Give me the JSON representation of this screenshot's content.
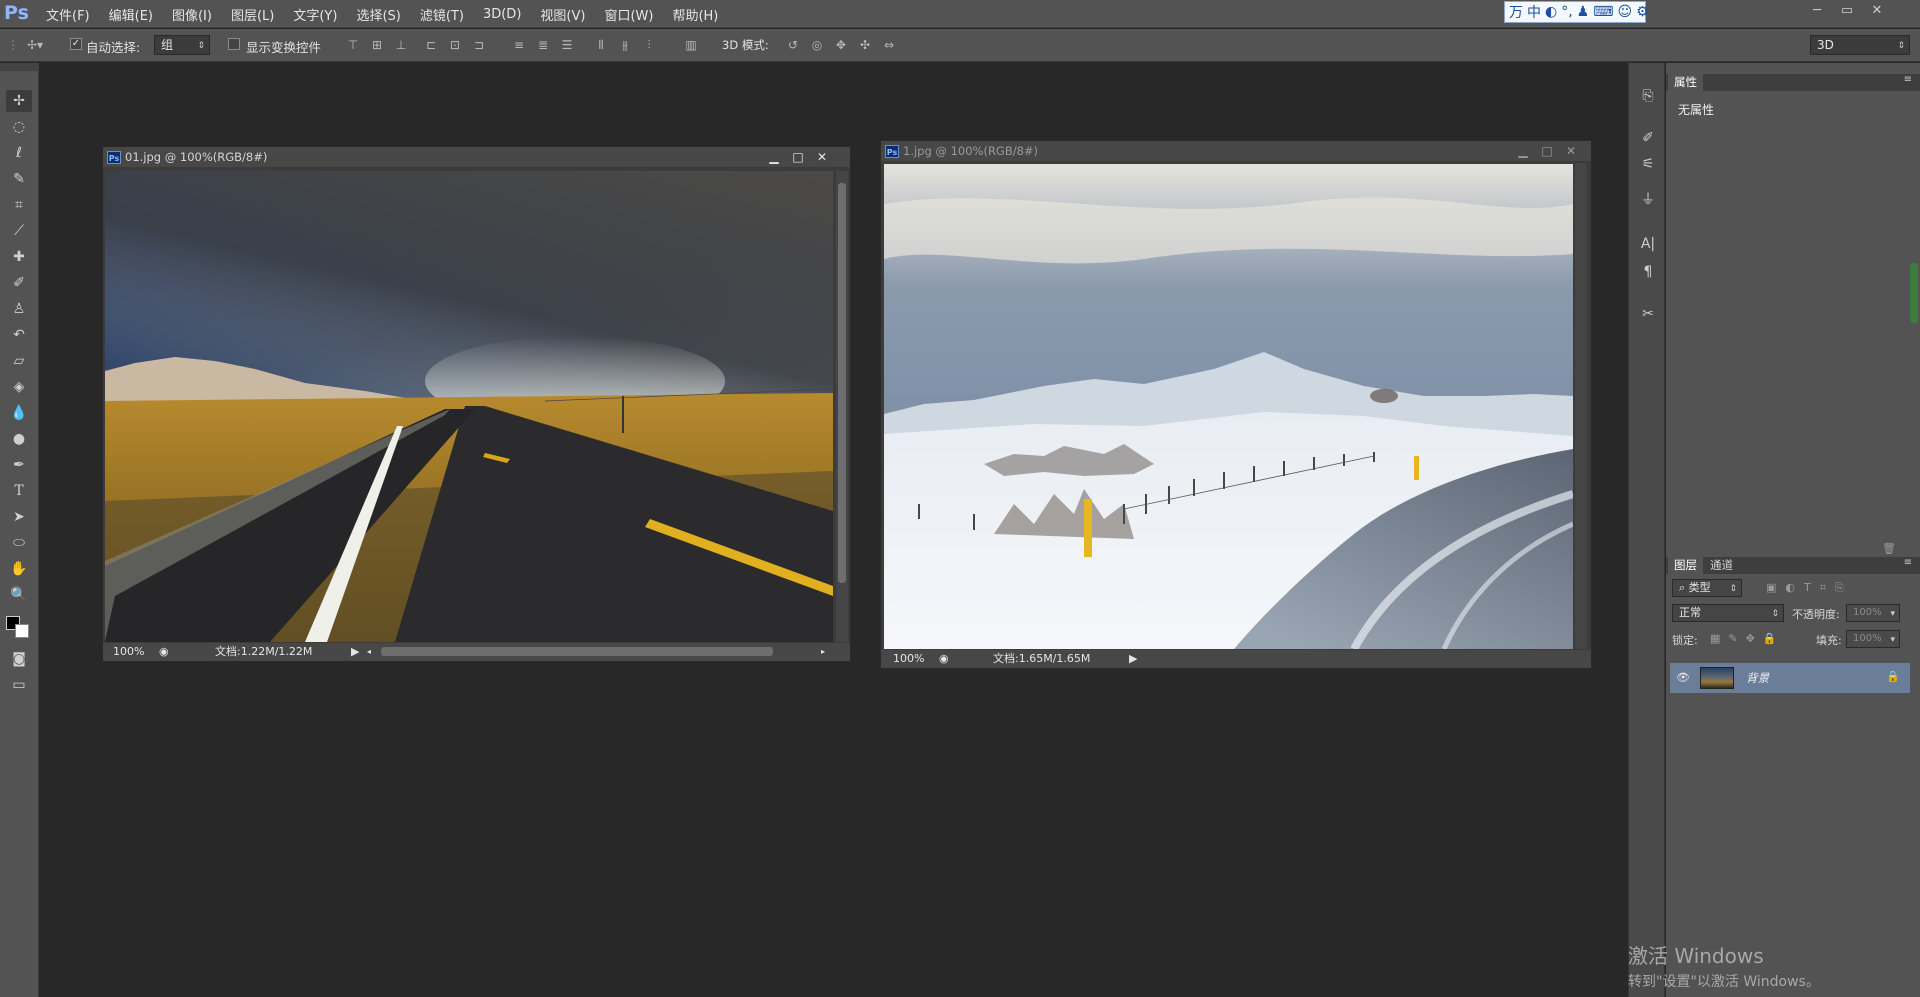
{
  "app": {
    "logo": "Ps"
  },
  "menu": [
    "文件(F)",
    "编辑(E)",
    "图像(I)",
    "图层(L)",
    "文字(Y)",
    "选择(S)",
    "滤镜(T)",
    "3D(D)",
    "视图(V)",
    "窗口(W)",
    "帮助(H)"
  ],
  "ime": {
    "items": [
      "万",
      "中",
      "◐",
      "°,",
      "♟",
      "⌨",
      "☺",
      "⚙"
    ]
  },
  "window_controls": {
    "minimize": "─",
    "restore": "▭",
    "close": "✕"
  },
  "options": {
    "auto_select_label": "自动选择:",
    "auto_select_checked": "✓",
    "auto_select_value": "组",
    "transform_label": "显示变换控件",
    "mode3d_label": "3D 模式:",
    "workspace_value": "3D"
  },
  "doc1": {
    "title": "01.jpg @ 100%(RGB/8#)",
    "zoom": "100%",
    "doc_info": "文档:1.22M/1.22M",
    "btn_min": "▁",
    "btn_max": "□",
    "btn_close": "✕"
  },
  "doc2": {
    "title": "1.jpg @ 100%(RGB/8#)",
    "zoom": "100%",
    "doc_info": "文档:1.65M/1.65M",
    "btn_min": "▁",
    "btn_max": "□",
    "btn_close": "✕"
  },
  "properties": {
    "tab": "属性",
    "empty_text": "无属性"
  },
  "layers": {
    "tab_layers": "图层",
    "tab_channels": "通道",
    "kind_filter": "类型",
    "blend_mode": "正常",
    "opacity_label": "不透明度:",
    "opacity_value": "100%",
    "lock_label": "锁定:",
    "fill_label": "填充:",
    "fill_value": "100%",
    "items": [
      {
        "name": "背景",
        "visible": true,
        "locked": true
      }
    ]
  },
  "activation": {
    "title": "激活 Windows",
    "subtitle": "转到\"设置\"以激活 Windows。"
  }
}
